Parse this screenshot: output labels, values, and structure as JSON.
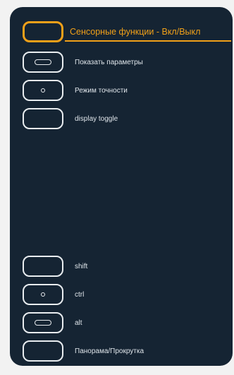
{
  "controls": {
    "top": [
      {
        "label": "Сенсорные функции - Вкл/Выкл",
        "icon": "none",
        "active": true
      },
      {
        "label": "Показать параметры",
        "icon": "pill-icon"
      },
      {
        "label": "Режим точности",
        "icon": "dot-icon"
      },
      {
        "label": "display toggle",
        "icon": "none"
      }
    ],
    "bottom": [
      {
        "label": "shift",
        "icon": "none"
      },
      {
        "label": "ctrl",
        "icon": "dot-icon"
      },
      {
        "label": "alt",
        "icon": "pill-icon"
      },
      {
        "label": "Панорама/Прокрутка",
        "icon": "none"
      }
    ]
  },
  "colors": {
    "panel_bg": "#152433",
    "accent": "#f0a019",
    "text": "#dfe5ea"
  }
}
